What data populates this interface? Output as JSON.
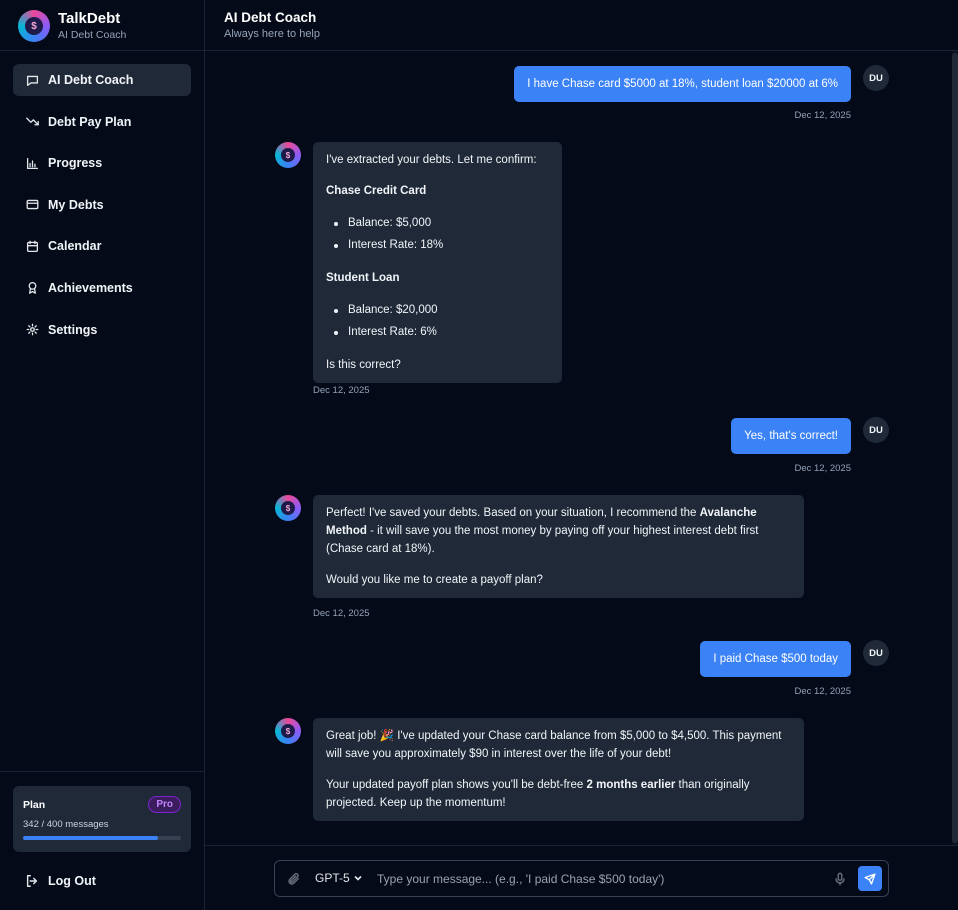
{
  "brand": {
    "name": "TalkDebt",
    "subtitle": "AI Debt Coach",
    "logo_glyph": "$"
  },
  "sidebar": {
    "items": [
      {
        "label": "AI Debt Coach",
        "icon": "chat-icon",
        "active": true
      },
      {
        "label": "Debt Pay Plan",
        "icon": "trending-down-icon",
        "active": false
      },
      {
        "label": "Progress",
        "icon": "bar-chart-icon",
        "active": false
      },
      {
        "label": "My Debts",
        "icon": "credit-card-icon",
        "active": false
      },
      {
        "label": "Calendar",
        "icon": "calendar-icon",
        "active": false
      },
      {
        "label": "Achievements",
        "icon": "award-icon",
        "active": false
      },
      {
        "label": "Settings",
        "icon": "gear-icon",
        "active": false
      }
    ],
    "plan": {
      "label": "Plan",
      "badge": "Pro",
      "usage": "342 / 400 messages",
      "used": 342,
      "limit": 400
    },
    "logout_label": "Log Out"
  },
  "header": {
    "title": "AI Debt Coach",
    "subtitle": "Always here to help"
  },
  "chat": {
    "user_avatar": "DU",
    "messages": [
      {
        "role": "user",
        "text": "I have Chase card $5000 at 18%, student loan $20000 at 6%",
        "time": "Dec 12, 2025"
      },
      {
        "role": "assistant",
        "intro": "I've extracted your debts. Let me confirm:",
        "debt1_name": "Chase Credit Card",
        "debt1_balance": "Balance: $5,000",
        "debt1_rate": "Interest Rate: 18%",
        "debt2_name": "Student Loan",
        "debt2_balance": "Balance: $20,000",
        "debt2_rate": "Interest Rate: 6%",
        "question": "Is this correct?",
        "time": "Dec 12, 2025"
      },
      {
        "role": "user",
        "text": "Yes, that's correct!",
        "time": "Dec 12, 2025"
      },
      {
        "role": "assistant",
        "p1_before": "Perfect! I've saved your debts. Based on your situation, I recommend the ",
        "p1_bold": "Avalanche Method",
        "p1_after": " - it will save you the most money by paying off your highest interest debt first (Chase card at 18%).",
        "p2": "Would you like me to create a payoff plan?",
        "time": "Dec 12, 2025"
      },
      {
        "role": "user",
        "text": "I paid Chase $500 today",
        "time": "Dec 12, 2025"
      },
      {
        "role": "assistant",
        "p1": "Great job! 🎉 I've updated your Chase card balance from $5,000 to $4,500. This payment will save you approximately $90 in interest over the life of your debt!",
        "p2_before": "Your updated payoff plan shows you'll be debt-free ",
        "p2_bold": "2 months earlier",
        "p2_after": " than originally projected. Keep up the momentum!"
      }
    ]
  },
  "composer": {
    "model": "GPT-5",
    "placeholder": "Type your message... (e.g., 'I paid Chase $500 today')"
  },
  "colors": {
    "accent": "#3b82f6",
    "background": "#050a18",
    "bubble": "#1f2937",
    "badge": "#c084fc"
  }
}
